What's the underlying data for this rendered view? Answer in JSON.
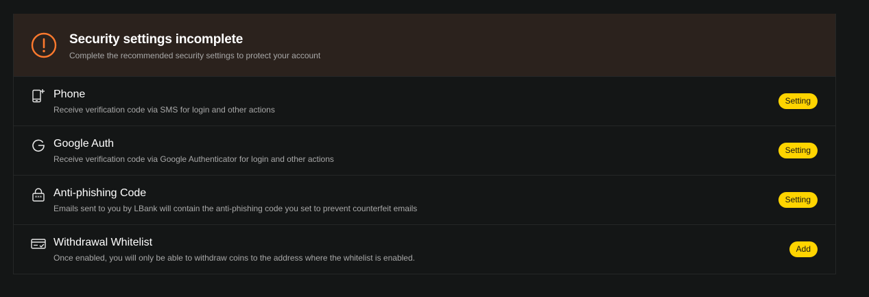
{
  "banner": {
    "title": "Security settings incomplete",
    "subtitle": "Complete the recommended security settings to protect your account",
    "icon": "warning-circle-icon",
    "accent": "#ff7a2e"
  },
  "items": [
    {
      "icon": "phone-icon",
      "title": "Phone",
      "description": "Receive verification code via SMS for login and other actions",
      "action": "Setting"
    },
    {
      "icon": "google-icon",
      "title": "Google Auth",
      "description": "Receive verification code via Google Authenticator for login and other actions",
      "action": "Setting"
    },
    {
      "icon": "lock-code-icon",
      "title": "Anti-phishing Code",
      "description": "Emails sent to you by LBank will contain the anti-phishing code you set to prevent counterfeit emails",
      "action": "Setting"
    },
    {
      "icon": "card-check-icon",
      "title": "Withdrawal Whitelist",
      "description": "Once enabled, you will only be able to withdraw coins to the address where the whitelist is enabled.",
      "action": "Add"
    }
  ],
  "colors": {
    "button": "#ffd400",
    "banner_bg": "#2b221d",
    "page_bg": "#141616"
  }
}
